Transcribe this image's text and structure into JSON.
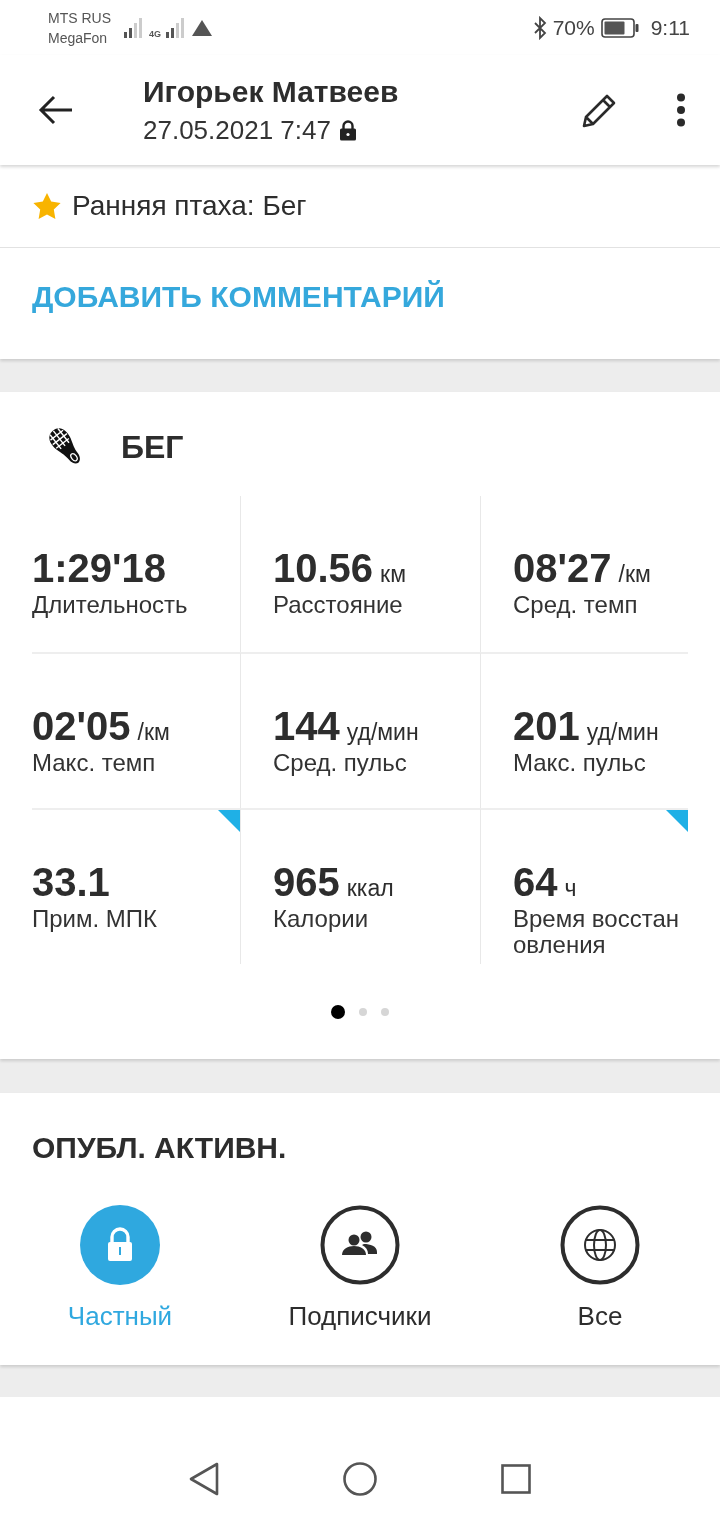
{
  "status_bar": {
    "carriers": [
      "MTS RUS",
      "MegaFon"
    ],
    "network_type": "4G",
    "battery": "70%",
    "time": "9:11"
  },
  "header": {
    "title": "Игорьек Матвеев",
    "date": "27.05.2021 7:47",
    "locked": true
  },
  "achievement": {
    "text": "Ранняя птаха: Бег"
  },
  "comment_link": "ДОБАВИТЬ КОММЕНТАРИЙ",
  "workout": {
    "activity": "БЕГ",
    "stats": [
      {
        "value": "1:29'18",
        "label": "Длительность",
        "marked": false
      },
      {
        "value": "10.56",
        "unit": "км",
        "label": "Расстояние",
        "marked": false
      },
      {
        "value": "08'27",
        "unit": "/км",
        "label": "Сред. темп",
        "marked": false
      },
      {
        "value": "02'05",
        "unit": "/км",
        "label": "Макс. темп",
        "marked": false
      },
      {
        "value": "144",
        "unit": "уд/мин",
        "label": "Сред. пульс",
        "marked": false
      },
      {
        "value": "201",
        "unit": "уд/мин",
        "label": "Макс. пульс",
        "marked": false
      },
      {
        "value": "33.1",
        "label": "Прим. МПК",
        "marked": true
      },
      {
        "value": "965",
        "unit": "ккал",
        "label": "Калории",
        "marked": false
      },
      {
        "value": "64",
        "unit": "ч",
        "label": "Время восстановления",
        "marked": true
      }
    ],
    "pages": [
      {
        "selected": true
      },
      {
        "selected": false
      },
      {
        "selected": false
      }
    ]
  },
  "privacy": {
    "title": "ОПУБЛ. АКТИВН.",
    "options": [
      {
        "kind": "lock",
        "label": "Частный",
        "selected": true
      },
      {
        "kind": "people",
        "label": "Подписчики",
        "selected": false
      },
      {
        "kind": "globe",
        "label": "Все",
        "selected": false
      }
    ]
  }
}
